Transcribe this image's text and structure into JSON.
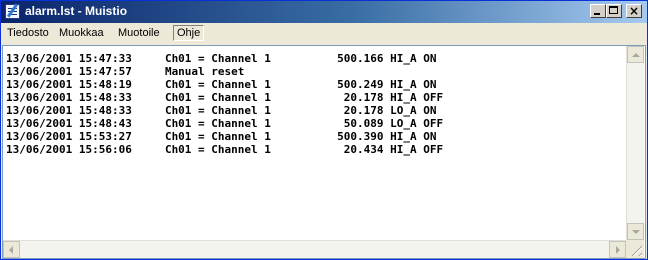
{
  "window": {
    "title": "alarm.lst - Muistio"
  },
  "menu": {
    "items": [
      "Tiedosto",
      "Muokkaa",
      "Muotoile",
      "Ohje"
    ]
  },
  "document": {
    "lines": [
      "13/06/2001 15:47:33     Ch01 = Channel 1          500.166 HI_A ON",
      "13/06/2001 15:47:57     Manual reset",
      "13/06/2001 15:48:19     Ch01 = Channel 1          500.249 HI_A ON",
      "13/06/2001 15:48:33     Ch01 = Channel 1           20.178 HI_A OFF",
      "13/06/2001 15:48:33     Ch01 = Channel 1           20.178 LO_A ON",
      "13/06/2001 15:48:43     Ch01 = Channel 1           50.089 LO_A OFF",
      "13/06/2001 15:53:27     Ch01 = Channel 1          500.390 HI_A ON",
      "13/06/2001 15:56:06     Ch01 = Channel 1           20.434 HI_A OFF"
    ]
  },
  "icons": {
    "app": "notepad-icon",
    "minimize": "minimize-icon",
    "maximize": "maximize-icon",
    "close": "close-icon"
  },
  "colors": {
    "titlebar_start": "#0a246a",
    "titlebar_end": "#a6caf0",
    "window_face": "#ece9d8"
  }
}
